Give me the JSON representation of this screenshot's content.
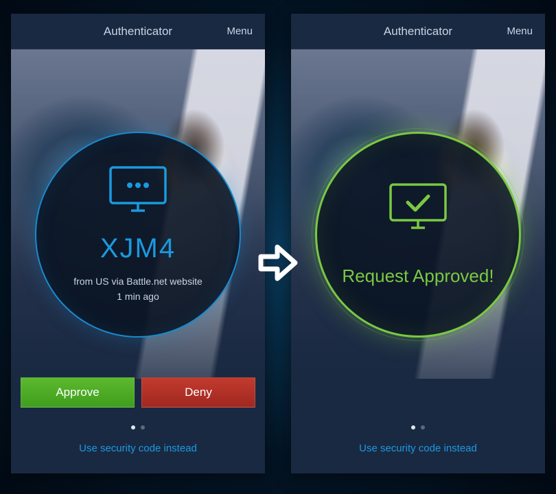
{
  "left": {
    "header": {
      "title": "Authenticator",
      "menu": "Menu"
    },
    "request": {
      "code": "XJM4",
      "source": "from US via Battle.net website",
      "time": "1 min ago"
    },
    "buttons": {
      "approve": "Approve",
      "deny": "Deny"
    },
    "alt_link": "Use security code instead"
  },
  "right": {
    "header": {
      "title": "Authenticator",
      "menu": "Menu"
    },
    "result": {
      "message": "Request Approved!"
    },
    "alt_link": "Use security code instead"
  },
  "colors": {
    "accent_blue": "#1a9ae0",
    "accent_green": "#7ac943",
    "approve_btn": "#4aab24",
    "deny_btn": "#b2312a"
  }
}
